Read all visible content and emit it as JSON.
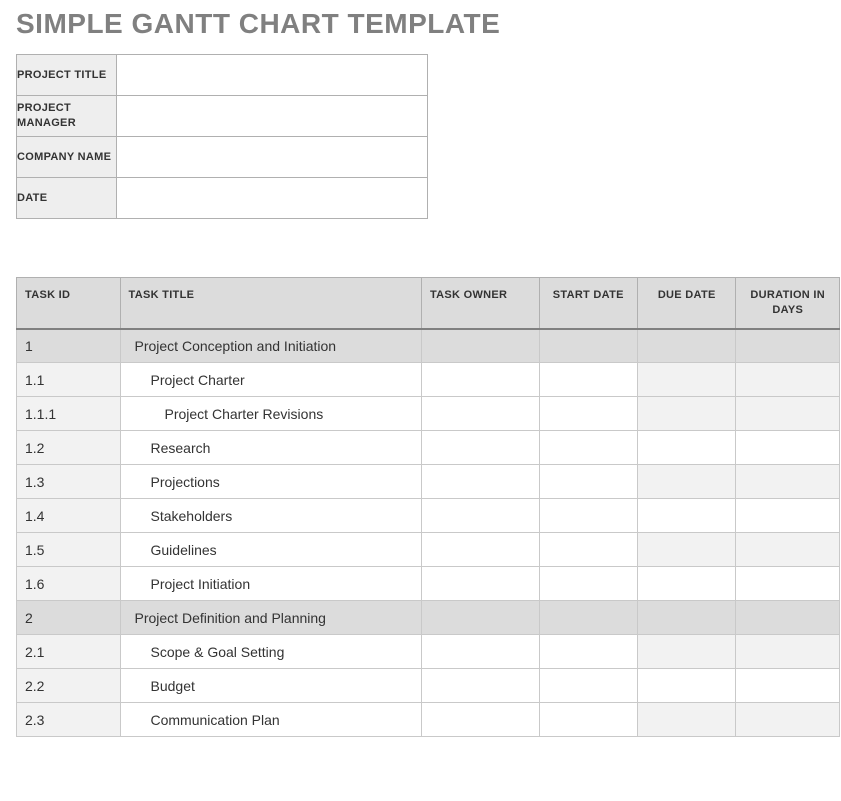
{
  "title": "SIMPLE GANTT CHART TEMPLATE",
  "info": {
    "rows": [
      {
        "label": "PROJECT TITLE",
        "value": ""
      },
      {
        "label": "PROJECT MANAGER",
        "value": ""
      },
      {
        "label": "COMPANY NAME",
        "value": ""
      },
      {
        "label": "DATE",
        "value": ""
      }
    ]
  },
  "columns": {
    "id": "TASK ID",
    "title": "TASK TITLE",
    "owner": "TASK OWNER",
    "start": "START DATE",
    "due": "DUE DATE",
    "dur": "DURATION IN DAYS"
  },
  "tasks": [
    {
      "id": "1",
      "title": "Project Conception and Initiation",
      "owner": "",
      "start": "",
      "due": "",
      "dur": "",
      "section": true,
      "indent": 0
    },
    {
      "id": "1.1",
      "title": "Project Charter",
      "owner": "",
      "start": "",
      "due": "",
      "dur": "",
      "section": false,
      "indent": 1,
      "altLast2": true
    },
    {
      "id": "1.1.1",
      "title": "Project Charter Revisions",
      "owner": "",
      "start": "",
      "due": "",
      "dur": "",
      "section": false,
      "indent": 2,
      "altLast2": true
    },
    {
      "id": "1.2",
      "title": "Research",
      "owner": "",
      "start": "",
      "due": "",
      "dur": "",
      "section": false,
      "indent": 1
    },
    {
      "id": "1.3",
      "title": "Projections",
      "owner": "",
      "start": "",
      "due": "",
      "dur": "",
      "section": false,
      "indent": 1,
      "altLast2": true
    },
    {
      "id": "1.4",
      "title": "Stakeholders",
      "owner": "",
      "start": "",
      "due": "",
      "dur": "",
      "section": false,
      "indent": 1
    },
    {
      "id": "1.5",
      "title": "Guidelines",
      "owner": "",
      "start": "",
      "due": "",
      "dur": "",
      "section": false,
      "indent": 1,
      "altLast2": true
    },
    {
      "id": "1.6",
      "title": "Project Initiation",
      "owner": "",
      "start": "",
      "due": "",
      "dur": "",
      "section": false,
      "indent": 1
    },
    {
      "id": "2",
      "title": "Project Definition and Planning",
      "owner": "",
      "start": "",
      "due": "",
      "dur": "",
      "section": true,
      "indent": 0
    },
    {
      "id": "2.1",
      "title": "Scope & Goal Setting",
      "owner": "",
      "start": "",
      "due": "",
      "dur": "",
      "section": false,
      "indent": 1,
      "altLast2": true
    },
    {
      "id": "2.2",
      "title": "Budget",
      "owner": "",
      "start": "",
      "due": "",
      "dur": "",
      "section": false,
      "indent": 1
    },
    {
      "id": "2.3",
      "title": "Communication Plan",
      "owner": "",
      "start": "",
      "due": "",
      "dur": "",
      "section": false,
      "indent": 1,
      "altLast2": true
    }
  ]
}
